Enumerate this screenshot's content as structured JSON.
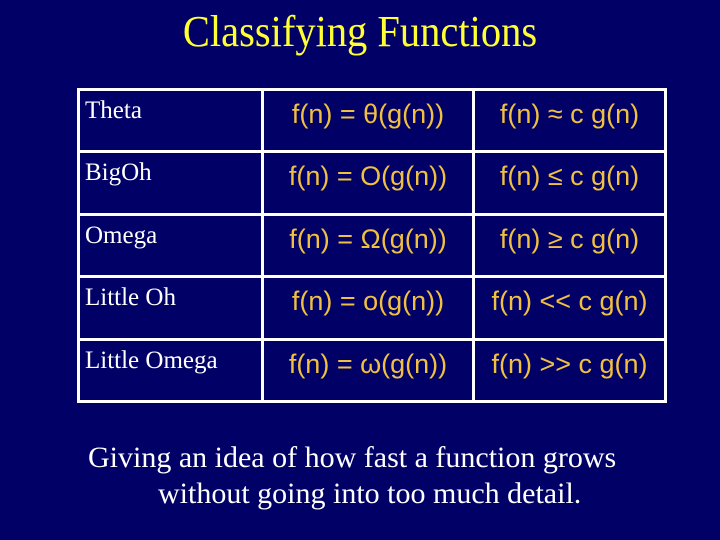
{
  "title": "Classifying Functions",
  "table": {
    "rows": [
      {
        "name": "Theta",
        "definition": "f(n) = θ(g(n))",
        "relation": "f(n) ≈ c g(n)"
      },
      {
        "name": "BigOh",
        "definition": "f(n) = O(g(n))",
        "relation": "f(n) ≤ c g(n)"
      },
      {
        "name": "Omega",
        "definition": "f(n) = Ω(g(n))",
        "relation": "f(n) ≥ c g(n)"
      },
      {
        "name": "Little Oh",
        "definition": "f(n) = o(g(n))",
        "relation": "f(n) << c g(n)"
      },
      {
        "name": "Little Omega",
        "definition": "f(n) = ω(g(n))",
        "relation": "f(n) >> c g(n)"
      }
    ]
  },
  "summary": {
    "line1": "Giving an idea of how fast a function grows",
    "line2": "without going into too much detail."
  },
  "colors": {
    "background": "#000066",
    "title": "#ffff33",
    "formula": "#f0c040",
    "text": "#ffffff"
  }
}
